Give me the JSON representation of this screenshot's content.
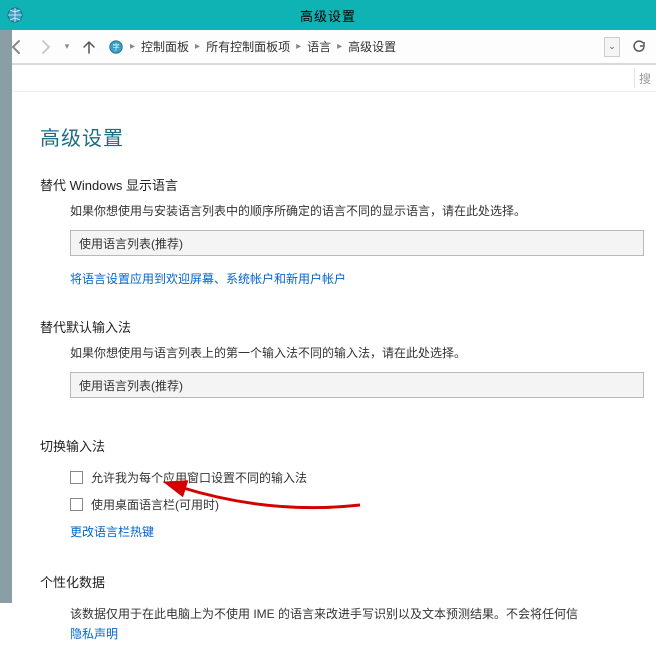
{
  "window": {
    "title": "高级设置"
  },
  "breadcrumb": {
    "items": [
      "控制面板",
      "所有控制面板项",
      "语言",
      "高级设置"
    ]
  },
  "search": {
    "placeholder": "搜"
  },
  "heading": "高级设置",
  "section1": {
    "title": "替代 Windows 显示语言",
    "desc": "如果你想使用与安装语言列表中的顺序所确定的语言不同的显示语言，请在此处选择。",
    "select": "使用语言列表(推荐)",
    "link": "将语言设置应用到欢迎屏幕、系统帐户和新用户帐户"
  },
  "section2": {
    "title": "替代默认输入法",
    "desc": "如果你想使用与语言列表上的第一个输入法不同的输入法，请在此处选择。",
    "select": "使用语言列表(推荐)"
  },
  "section3": {
    "title": "切换输入法",
    "cb1": "允许我为每个应用窗口设置不同的输入法",
    "cb2": "使用桌面语言栏(可用时)",
    "link": "更改语言栏热键"
  },
  "section4": {
    "title": "个性化数据",
    "desc": "该数据仅用于在此电脑上为不使用 IME 的语言来改进手写识别以及文本预测结果。不会将任何信",
    "link": "隐私声明"
  }
}
